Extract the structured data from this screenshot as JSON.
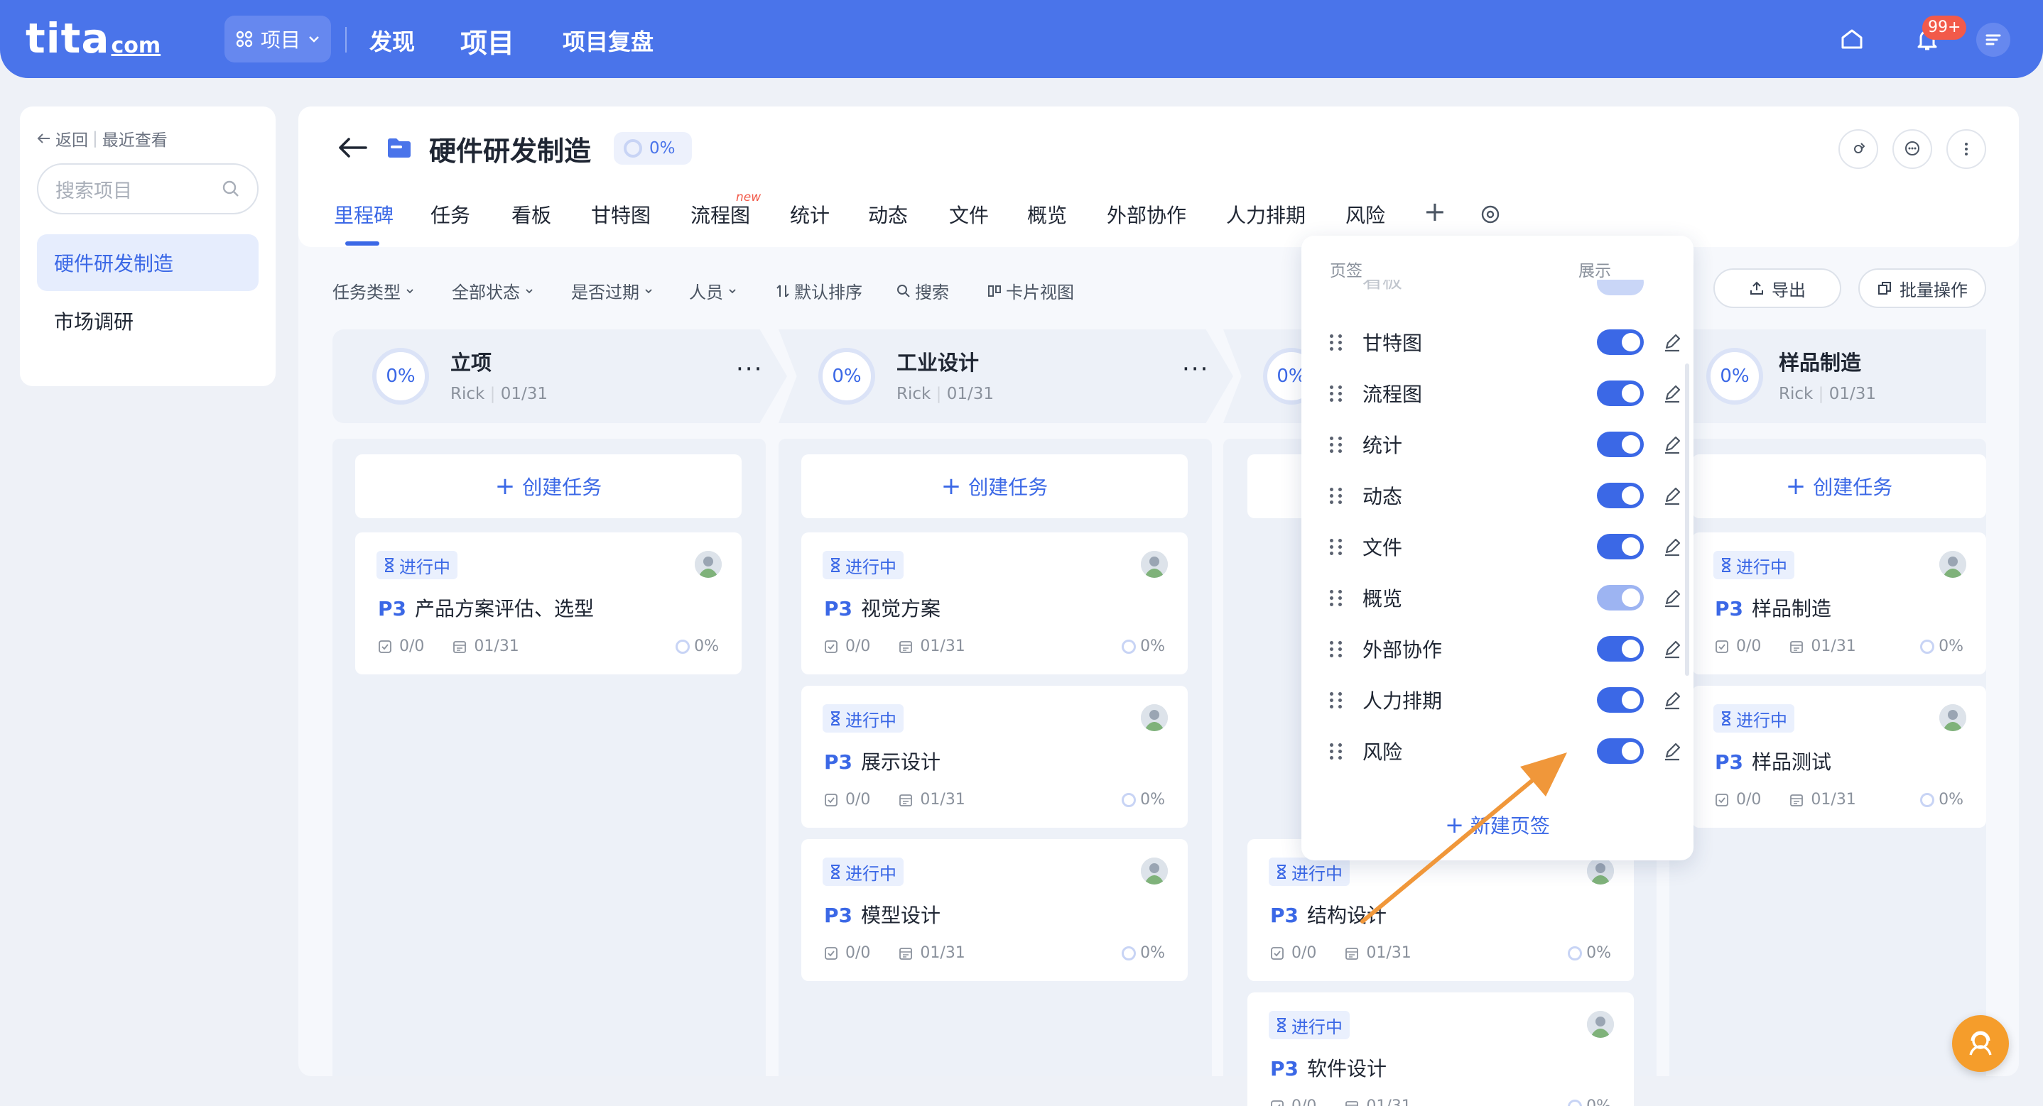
{
  "brand": {
    "logo_main": "tita",
    "logo_sub": "com"
  },
  "topnav": {
    "switch_label": "项目",
    "items": [
      "发现",
      "项目",
      "项目复盘"
    ],
    "badge": "99+"
  },
  "sidebar": {
    "back": "返回",
    "recent": "最近查看",
    "search_placeholder": "搜索项目",
    "items": [
      "硬件研发制造",
      "市场调研"
    ]
  },
  "project": {
    "title": "硬件研发制造",
    "progress": "0%"
  },
  "tabs": {
    "items": [
      "里程碑",
      "任务",
      "看板",
      "甘特图",
      "流程图",
      "统计",
      "动态",
      "文件",
      "概览",
      "外部协作",
      "人力排期",
      "风险"
    ],
    "new_tag": "new",
    "active_index": 0
  },
  "filters": {
    "items": [
      "任务类型",
      "全部状态",
      "是否过期",
      "人员",
      "默认排序",
      "搜索",
      "卡片视图"
    ],
    "export": "导出",
    "bulk": "批量操作"
  },
  "columns": [
    {
      "title": "立项",
      "owner": "Rick",
      "date": "01/31",
      "progress": "0%"
    },
    {
      "title": "工业设计",
      "owner": "Rick",
      "date": "01/31",
      "progress": "0%"
    },
    {
      "title": "",
      "owner": "",
      "date": "",
      "progress": "0%"
    },
    {
      "title": "样品制造",
      "owner": "Rick",
      "date": "01/31",
      "progress": "0%"
    }
  ],
  "create_task": "创建任务",
  "cards": {
    "status": "进行中",
    "priority": "P3",
    "subtasks": "0/0",
    "date": "01/31",
    "progress": "0%",
    "col1": [
      "产品方案评估、选型"
    ],
    "col2": [
      "视觉方案",
      "展示设计",
      "模型设计"
    ],
    "col3": [
      "结构设计",
      "软件设计"
    ],
    "col4": [
      "样品制造",
      "样品测试"
    ]
  },
  "dropdown": {
    "header_tab": "页签",
    "header_show": "展示",
    "partial_top": "看板",
    "rows": [
      {
        "label": "甘特图",
        "on": true
      },
      {
        "label": "流程图",
        "on": true
      },
      {
        "label": "统计",
        "on": true
      },
      {
        "label": "动态",
        "on": true
      },
      {
        "label": "文件",
        "on": true
      },
      {
        "label": "概览",
        "on": false
      },
      {
        "label": "外部协作",
        "on": true
      },
      {
        "label": "人力排期",
        "on": true
      },
      {
        "label": "风险",
        "on": true
      }
    ],
    "new_tab": "新建页签"
  },
  "colors": {
    "primary": "#3b68e6",
    "topbar": "#4a74ea",
    "annotation_arrow": "#f0973a"
  }
}
